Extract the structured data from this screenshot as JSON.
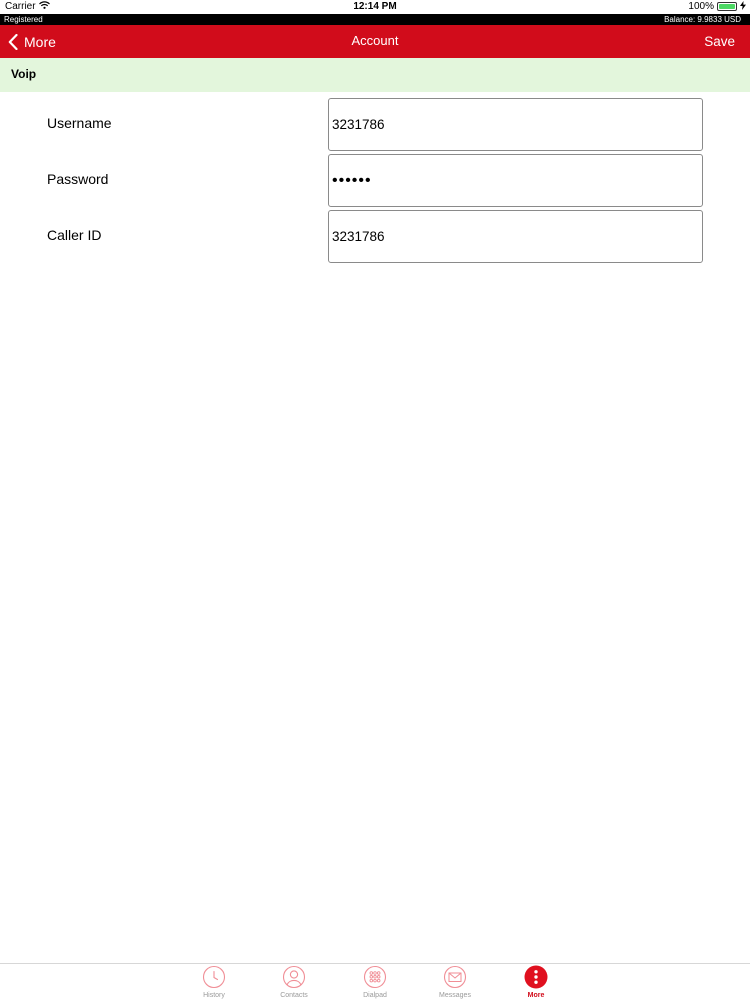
{
  "status_bar": {
    "carrier": "Carrier",
    "time": "12:14 PM",
    "battery_percent": "100%",
    "battery_level": 1.0
  },
  "reg_bar": {
    "status": "Registered",
    "balance": "Balance: 9.9833 USD"
  },
  "nav": {
    "back_label": "More",
    "title": "Account",
    "save_label": "Save"
  },
  "section": {
    "title": "Voip"
  },
  "fields": {
    "username": {
      "label": "Username",
      "value": "3231786"
    },
    "password": {
      "label": "Password",
      "value": "••••••"
    },
    "caller_id": {
      "label": "Caller ID",
      "value": "3231786"
    }
  },
  "tabs": [
    {
      "label": "History",
      "icon": "clock-icon"
    },
    {
      "label": "Contacts",
      "icon": "person-icon"
    },
    {
      "label": "Dialpad",
      "icon": "dialpad-icon"
    },
    {
      "label": "Messages",
      "icon": "envelope-icon"
    },
    {
      "label": "More",
      "icon": "more-icon"
    }
  ],
  "colors": {
    "brand_red": "#d10c1b",
    "section_bg": "#e3f6dc",
    "tab_inactive": "#f08e96"
  }
}
